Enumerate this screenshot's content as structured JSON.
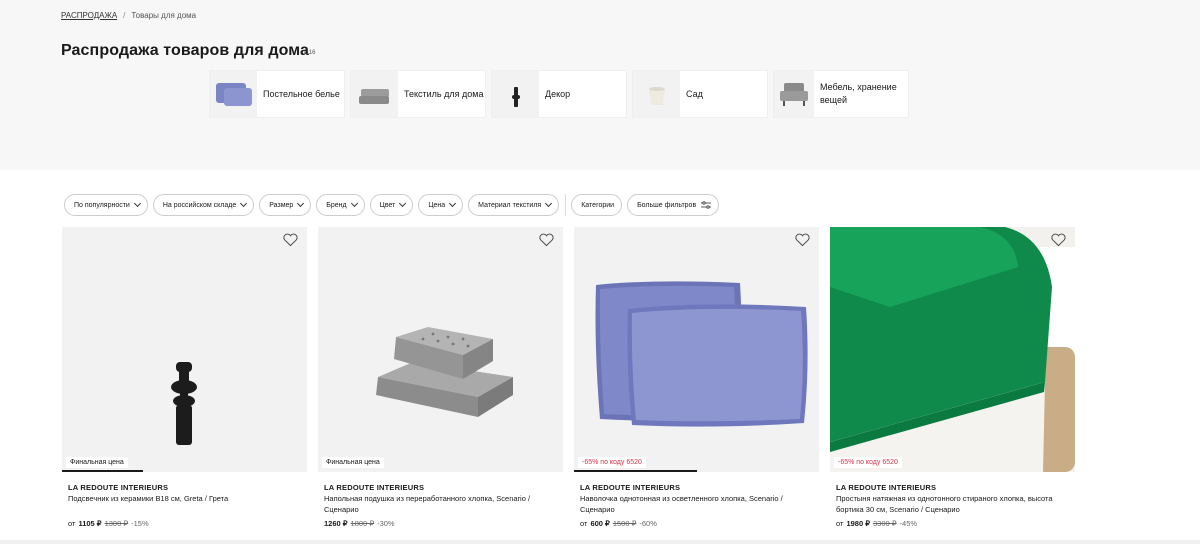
{
  "breadcrumb": {
    "home": "РАСПРОДАЖА",
    "separator": "/",
    "current": "Товары для дома"
  },
  "page_title": "Распродажа товаров для дома",
  "result_count": "1116",
  "categories": [
    {
      "label": "Постельное белье",
      "icon": "pillow-icon"
    },
    {
      "label": "Текстиль для дома",
      "icon": "cushion-icon"
    },
    {
      "label": "Декор",
      "icon": "candlestick-icon"
    },
    {
      "label": "Сад",
      "icon": "planter-icon"
    },
    {
      "label": "Мебель, хранение вещей",
      "icon": "armchair-icon"
    }
  ],
  "filters": [
    "По популярности",
    "На российском складе",
    "Размер",
    "Бренд",
    "Цвет",
    "Цена",
    "Материал текстиля",
    "Категории",
    "Больше фильтров"
  ],
  "products": [
    {
      "badge": "Финальная цена",
      "badge_type": "final",
      "brand": "LA REDOUTE INTERIEURS",
      "name": "Подсвечник из керамики B18 см, Greta / Грета",
      "price_prefix": "от",
      "price": "1105 ₽",
      "old_price": "1300 ₽",
      "discount": "-15%",
      "progress": 0.33
    },
    {
      "badge": "Финальная цена",
      "badge_type": "final",
      "brand": "LA REDOUTE INTERIEURS",
      "name": "Напольная подушка из переработанного хлопка, Scenario / Сценарио",
      "price_prefix": "",
      "price": "1260 ₽",
      "old_price": "1800 ₽",
      "discount": "-30%",
      "progress": 0
    },
    {
      "badge": "-65% по коду 6520",
      "badge_type": "promo",
      "brand": "LA REDOUTE INTERIEURS",
      "name": "Наволочка однотонная из осветленного хлопка, Scenario / Сценарио",
      "price_prefix": "от",
      "price": "600 ₽",
      "old_price": "1500 ₽",
      "discount": "-60%",
      "progress": 0.5
    },
    {
      "badge": "-65% по коду 6520",
      "badge_type": "promo",
      "brand": "LA REDOUTE INTERIEURS",
      "name": "Простыня натяжная из однотонного стираного хлопка, высота бортика 30 см, Scenario / Сценарио",
      "price_prefix": "от",
      "price": "1980 ₽",
      "old_price": "3300 ₽",
      "discount": "-45%",
      "progress": 0
    }
  ],
  "colors": {
    "promo": "#d6334a",
    "pillow_blue": "#7b84c4",
    "sheet_green": "#0f8a4a"
  }
}
